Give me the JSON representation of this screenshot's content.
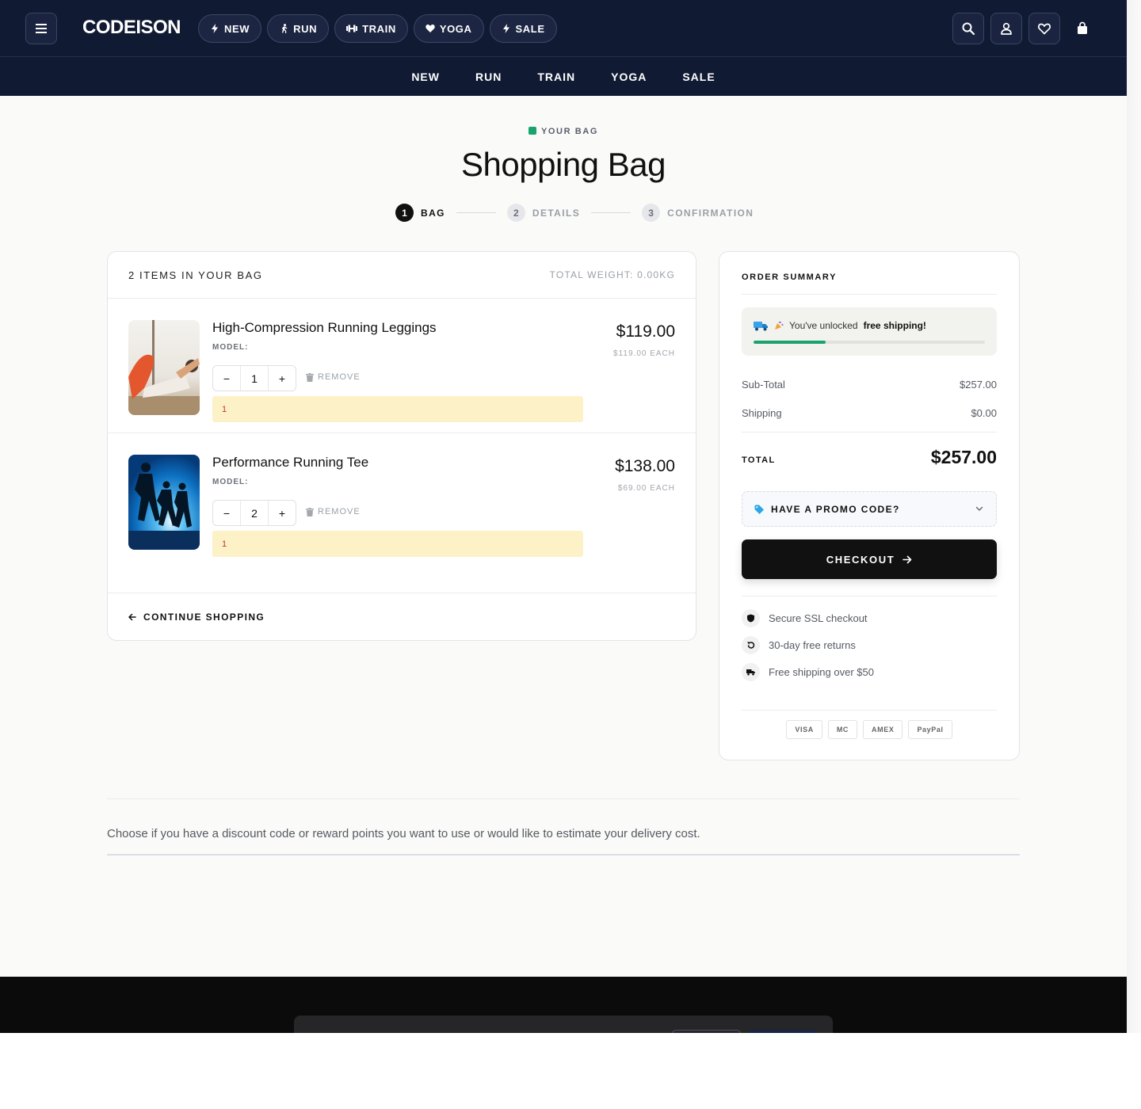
{
  "header": {
    "logo": "CODEISON",
    "pills": [
      {
        "label": "NEW",
        "icon": "bolt-icon"
      },
      {
        "label": "RUN",
        "icon": "runner-icon"
      },
      {
        "label": "TRAIN",
        "icon": "dumbbell-icon"
      },
      {
        "label": "YOGA",
        "icon": "heart-icon"
      },
      {
        "label": "SALE",
        "icon": "bolt-icon"
      }
    ],
    "nav": [
      "NEW",
      "RUN",
      "TRAIN",
      "YOGA",
      "SALE"
    ]
  },
  "page": {
    "eyebrow": "YOUR BAG",
    "title": "Shopping Bag",
    "steps": [
      {
        "num": "1",
        "label": "BAG",
        "active": true
      },
      {
        "num": "2",
        "label": "DETAILS",
        "active": false
      },
      {
        "num": "3",
        "label": "CONFIRMATION",
        "active": false
      }
    ]
  },
  "cart": {
    "count_label": "2 ITEMS IN YOUR BAG",
    "weight_label": "TOTAL WEIGHT: 0.00KG",
    "items": [
      {
        "name": "High-Compression Running Leggings",
        "model_label": "MODEL:",
        "qty": "1",
        "minus": "−",
        "plus": "+",
        "remove_label": "REMOVE",
        "note": "1",
        "price": "$119.00",
        "each": "$119.00 EACH"
      },
      {
        "name": "Performance Running Tee",
        "model_label": "MODEL:",
        "qty": "2",
        "minus": "−",
        "plus": "+",
        "remove_label": "REMOVE",
        "note": "1",
        "price": "$138.00",
        "each": "$69.00 EACH"
      }
    ],
    "continue_label": "CONTINUE SHOPPING"
  },
  "summary": {
    "title": "ORDER SUMMARY",
    "ship_msg_pre": "You've unlocked",
    "ship_msg_bold": "free shipping!",
    "ship_progress": 0.31,
    "subtotal_label": "Sub-Total",
    "subtotal_value": "$257.00",
    "shipping_label": "Shipping",
    "shipping_value": "$0.00",
    "total_label": "TOTAL",
    "total_value": "$257.00",
    "promo_label": "HAVE A PROMO CODE?",
    "checkout_label": "CHECKOUT",
    "perks": [
      "Secure SSL checkout",
      "30-day free returns",
      "Free shipping over $50"
    ],
    "cards": [
      "VISA",
      "MC",
      "AMEX",
      "PayPal"
    ]
  },
  "info": {
    "text": "Choose if you have a discount code or reward points you want to use or would like to estimate your delivery cost."
  },
  "colors": {
    "header_bg": "#111a33",
    "accent_green": "#1aa36f",
    "checkout_bg": "#111111",
    "note_bg": "#fdf1c7"
  }
}
